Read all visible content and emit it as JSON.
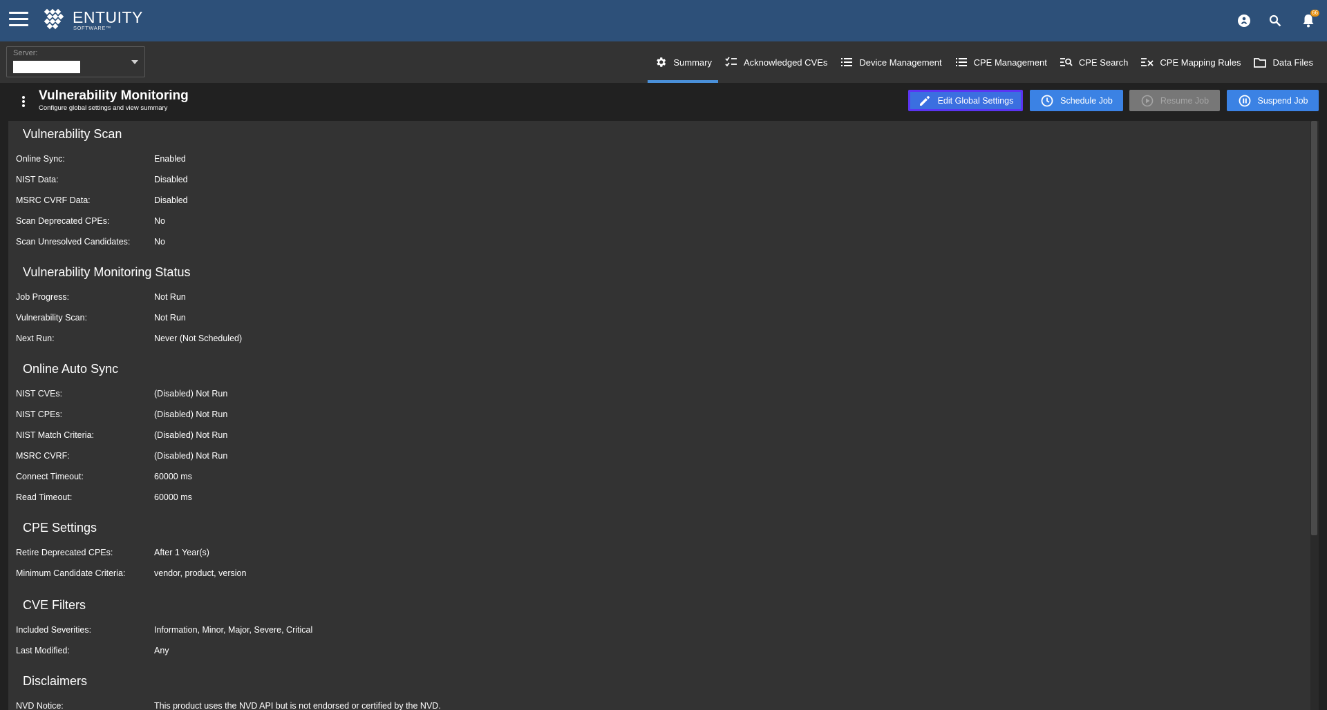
{
  "header": {
    "logo_name": "ENTUITY",
    "logo_sub": "SOFTWARE™",
    "notification_count": "66",
    "accent": "#2d5079"
  },
  "server": {
    "label": "Server:",
    "value": ""
  },
  "tabs": [
    {
      "label": "Summary",
      "icon": "gear-icon",
      "active": true
    },
    {
      "label": "Acknowledged CVEs",
      "icon": "checklist-icon"
    },
    {
      "label": "Device Management",
      "icon": "list-icon"
    },
    {
      "label": "CPE Management",
      "icon": "list-icon"
    },
    {
      "label": "CPE Search",
      "icon": "search-list-icon"
    },
    {
      "label": "CPE Mapping Rules",
      "icon": "mapping-rules-icon"
    },
    {
      "label": "Data Files",
      "icon": "folder-icon"
    }
  ],
  "page": {
    "title": "Vulnerability Monitoring",
    "subtitle": "Configure global settings and view summary"
  },
  "actions": {
    "edit": "Edit Global Settings",
    "schedule": "Schedule Job",
    "resume": "Resume Job",
    "suspend": "Suspend Job"
  },
  "sections": {
    "scan": {
      "title": "Vulnerability Scan",
      "rows": [
        {
          "label": "Online Sync:",
          "value": "Enabled"
        },
        {
          "label": "NIST Data:",
          "value": "Disabled"
        },
        {
          "label": "MSRC CVRF Data:",
          "value": "Disabled"
        },
        {
          "label": "Scan Deprecated CPEs:",
          "value": "No"
        },
        {
          "label": "Scan Unresolved Candidates:",
          "value": "No"
        }
      ]
    },
    "status": {
      "title": "Vulnerability Monitoring Status",
      "rows": [
        {
          "label": "Job Progress:",
          "value": "Not Run"
        },
        {
          "label": "Vulnerability Scan:",
          "value": "Not Run"
        },
        {
          "label": "Next Run:",
          "value": "Never (Not Scheduled)"
        }
      ]
    },
    "autosync": {
      "title": "Online Auto Sync",
      "rows": [
        {
          "label": "NIST CVEs:",
          "value": "(Disabled) Not Run"
        },
        {
          "label": "NIST CPEs:",
          "value": "(Disabled) Not Run"
        },
        {
          "label": "NIST Match Criteria:",
          "value": "(Disabled) Not Run"
        },
        {
          "label": "MSRC CVRF:",
          "value": "(Disabled) Not Run"
        },
        {
          "label": "Connect Timeout:",
          "value": "60000 ms"
        },
        {
          "label": "Read Timeout:",
          "value": "60000 ms"
        }
      ]
    },
    "cpe": {
      "title": "CPE Settings",
      "rows": [
        {
          "label": "Retire Deprecated CPEs:",
          "value": "After 1 Year(s)"
        },
        {
          "label": "Minimum Candidate Criteria:",
          "value": "vendor, product, version"
        }
      ]
    },
    "cve": {
      "title": "CVE Filters",
      "rows": [
        {
          "label": "Included Severities:",
          "value": "Information, Minor, Major, Severe, Critical"
        },
        {
          "label": "Last Modified:",
          "value": "Any"
        }
      ]
    },
    "disclaimers": {
      "title": "Disclaimers",
      "rows": [
        {
          "label": "NVD Notice:",
          "value": "This product uses the NVD API but is not endorsed or certified by the NVD."
        }
      ]
    }
  }
}
